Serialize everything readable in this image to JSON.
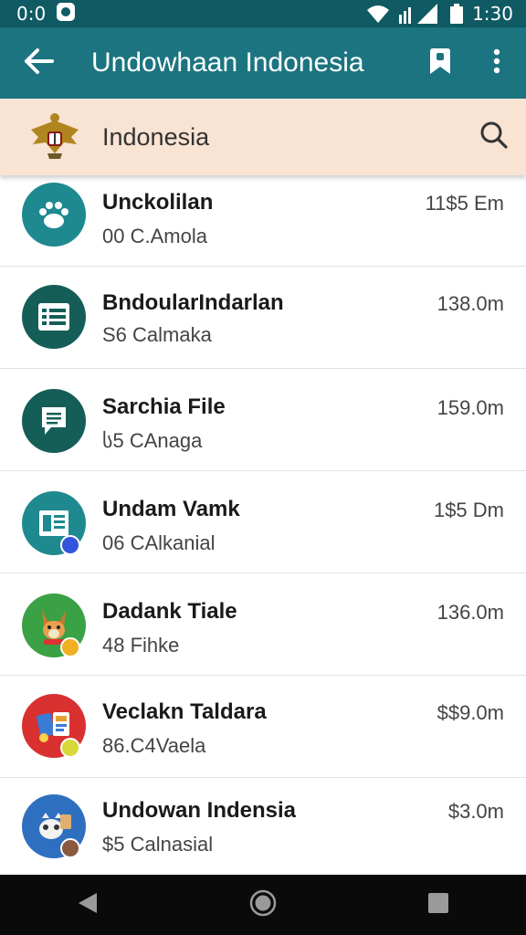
{
  "status_bar": {
    "left_text": "0:0",
    "time": "1:30",
    "icons": [
      "notification-icon",
      "wifi-icon",
      "signal-icon",
      "battery-icon"
    ]
  },
  "app_bar": {
    "title": "Undowhaan Indonesia",
    "icons": [
      "back-arrow-icon",
      "bookmark-icon",
      "more-vert-icon"
    ],
    "color": "#1b7480"
  },
  "search_bar": {
    "label": "Indonesia",
    "icons": [
      "garuda-emblem-icon",
      "search-icon"
    ],
    "color": "#f9e3d3"
  },
  "list": {
    "items": [
      {
        "title": "Unckolilan",
        "subtitle": "00 C.Amola",
        "amount": "11$5 Em",
        "icon": "paw-icon",
        "icon_color": "#1e8a90"
      },
      {
        "title": "BndoularIndarlan",
        "subtitle": "S6 Calmaka",
        "amount": "138.0m",
        "icon": "list-document-icon",
        "icon_color": "#155e57"
      },
      {
        "title": "Sarchia File",
        "subtitle": "ს5 CAnaga",
        "amount": "159.0m",
        "icon": "chat-note-icon",
        "icon_color": "#155e57"
      },
      {
        "title": "Undam Vamk",
        "subtitle": "06 CAlkanial",
        "amount": "1$5 Dm",
        "icon": "newspaper-icon",
        "icon_color": "#1e8a90",
        "badge_color": "#3355dd"
      },
      {
        "title": "Dadank Tiale",
        "subtitle": "48 Fihke",
        "amount": "136.0m",
        "icon": "cartoon-fox-icon",
        "icon_color": "#3aa144",
        "badge_color": "#f0b020"
      },
      {
        "title": "Veclakn Taldara",
        "subtitle": "86.C4Vaela",
        "amount": "$$9.0m",
        "icon": "cartoon-shop-icon",
        "icon_color": "#d93030",
        "badge_color": "#d8d83a"
      },
      {
        "title": "Undowan Indensia",
        "subtitle": "$5 Calnasial",
        "amount": "$3.0m",
        "icon": "cartoon-animal-icon",
        "icon_color": "#2f6fc0",
        "badge_color": "#8a5a40"
      }
    ]
  },
  "nav_bar": {
    "icons": [
      "back-triangle-icon",
      "home-circle-icon",
      "recents-square-icon"
    ]
  }
}
